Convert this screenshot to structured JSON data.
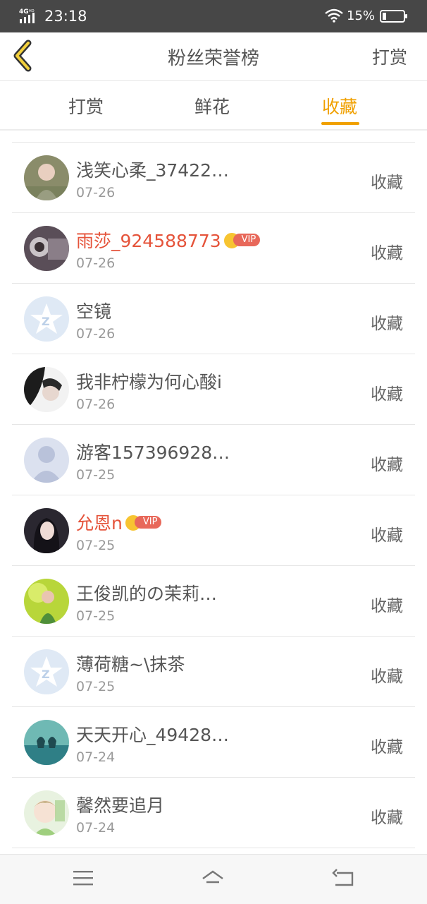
{
  "status_bar": {
    "network": "4G HD",
    "time": "23:18",
    "battery_percent": "15%"
  },
  "header": {
    "title": "粉丝荣誉榜",
    "action_label": "打赏"
  },
  "tabs": [
    {
      "label": "打赏",
      "active": false
    },
    {
      "label": "鲜花",
      "active": false
    },
    {
      "label": "收藏",
      "active": true
    }
  ],
  "colors": {
    "accent": "#f0a000",
    "vip_name": "#e5533a",
    "status_bar": "#474747"
  },
  "list": [
    {
      "name": "浅笑心柔_37422…",
      "date": "07-26",
      "action": "收藏",
      "vip": false,
      "avatar": "photo-child"
    },
    {
      "name": "雨莎_924588773",
      "date": "07-26",
      "action": "收藏",
      "vip": true,
      "vip_label": "VIP",
      "avatar": "photo-camera"
    },
    {
      "name": "空镜",
      "date": "07-26",
      "action": "收藏",
      "vip": false,
      "avatar": "default-star-avatar"
    },
    {
      "name": "我非柠檬为何心酸i",
      "date": "07-26",
      "action": "收藏",
      "vip": false,
      "avatar": "photo-woman-dark"
    },
    {
      "name": "游客157396928…",
      "date": "07-25",
      "action": "收藏",
      "vip": false,
      "avatar": "default-person-avatar"
    },
    {
      "name": "允恩n",
      "date": "07-25",
      "action": "收藏",
      "vip": true,
      "vip_label": "VIP",
      "avatar": "photo-woman-long-hair"
    },
    {
      "name": "王俊凯的の茉莉…",
      "date": "07-25",
      "action": "收藏",
      "vip": false,
      "avatar": "photo-green"
    },
    {
      "name": "薄荷糖~\\抹茶",
      "date": "07-25",
      "action": "收藏",
      "vip": false,
      "avatar": "default-star-avatar"
    },
    {
      "name": "天天开心_49428…",
      "date": "07-24",
      "action": "收藏",
      "vip": false,
      "avatar": "photo-teal-hands"
    },
    {
      "name": "馨然要追月",
      "date": "07-24",
      "action": "收藏",
      "vip": false,
      "avatar": "photo-cartoon"
    }
  ]
}
